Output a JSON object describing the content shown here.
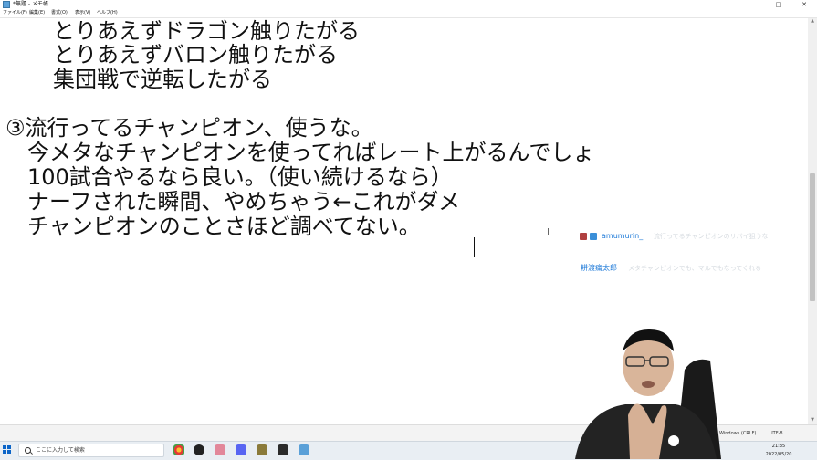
{
  "window": {
    "title": "*無題 - メモ帳",
    "controls": [
      "—",
      "□",
      "✕"
    ]
  },
  "menu": [
    "ファイル(F)",
    "編集(E)",
    "書式(O)",
    "表示(V)",
    "ヘルプ(H)"
  ],
  "document": {
    "lines": [
      "　とりあえずドラゴン触りたがる",
      "　とりあえずバロン触りたがる",
      "　集団戦で逆転したがる",
      "",
      "③流行ってるチャンピオン、使うな。",
      "　今メタなチャンピオンを使ってればレート上がるんでしょ",
      "　100試合やるなら良い。（使い続けるなら）",
      "　ナーフされた瞬間、やめちゃう←これがダメ",
      "　チャンピオンのことさほど調べてない。"
    ]
  },
  "chat": {
    "messages": [
      {
        "user": "amumurin_",
        "text": "流行ってるチャンピオンのリバイ狙うな"
      },
      {
        "user": "耕渡痛太郎",
        "text": "メタチャンピオンでも、マルでもなってくれる"
      }
    ]
  },
  "statusbar": {
    "encoding_line": "Windows (CRLF)",
    "encoding": "UTF-8"
  },
  "taskbar": {
    "search_placeholder": "ここに入力して検索",
    "time": "21:35",
    "date": "2022/05/20"
  },
  "colors": {
    "chat_user": "#1e7ad8",
    "taskbar": "#e9eef3",
    "start": "#0a64c8"
  },
  "icons": [
    "notepad-icon",
    "search-icon",
    "chrome-icon",
    "obs-icon",
    "browser-icon",
    "discord-icon",
    "game-icon",
    "app-icon",
    "notepad-app-icon"
  ]
}
